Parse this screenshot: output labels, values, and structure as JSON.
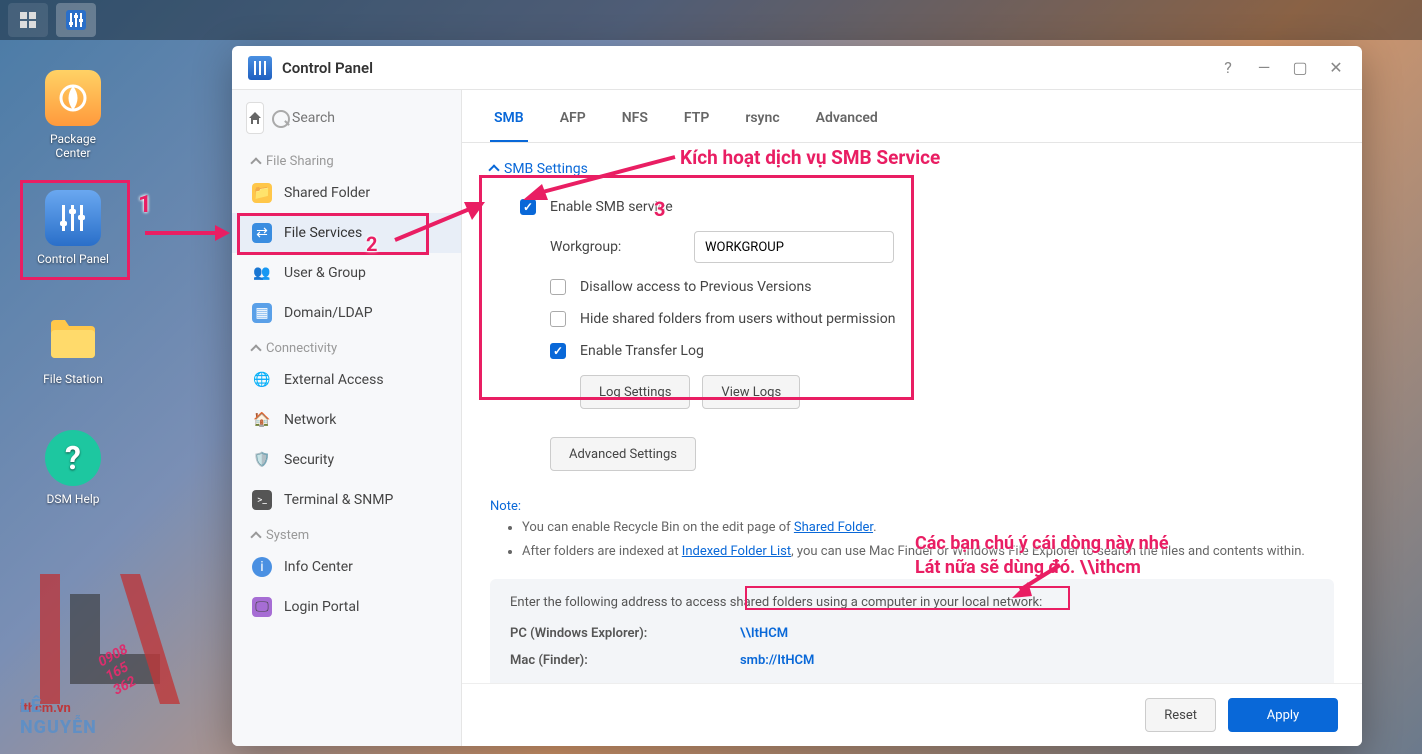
{
  "taskbar": {
    "items": [
      "menu",
      "control-panel-taskbar"
    ]
  },
  "desktop": {
    "package_center": "Package\nCenter",
    "control_panel": "Control Panel",
    "file_station": "File Station",
    "dsm_help": "DSM Help"
  },
  "window": {
    "title": "Control Panel",
    "search_placeholder": "Search"
  },
  "sidebar": {
    "section_file_sharing": "File Sharing",
    "shared_folder": "Shared Folder",
    "file_services": "File Services",
    "user_group": "User & Group",
    "domain_ldap": "Domain/LDAP",
    "section_connectivity": "Connectivity",
    "external_access": "External Access",
    "network": "Network",
    "security": "Security",
    "terminal_snmp": "Terminal & SNMP",
    "section_system": "System",
    "info_center": "Info Center",
    "login_portal": "Login Portal"
  },
  "tabs": {
    "smb": "SMB",
    "afp": "AFP",
    "nfs": "NFS",
    "ftp": "FTP",
    "rsync": "rsync",
    "advanced": "Advanced"
  },
  "content": {
    "section_header": "SMB Settings",
    "enable_smb": "Enable SMB service",
    "workgroup_label": "Workgroup:",
    "workgroup_value": "WORKGROUP",
    "disallow_prev": "Disallow access to Previous Versions",
    "hide_folders": "Hide shared folders from users without permission",
    "enable_log": "Enable Transfer Log",
    "log_settings": "Log Settings",
    "view_logs": "View Logs",
    "advanced_settings": "Advanced Settings",
    "note_title": "Note:",
    "note1_a": "You can enable Recycle Bin on the edit page of ",
    "note1_link": "Shared Folder",
    "note2_a": "After folders are indexed at ",
    "note2_link": "Indexed Folder List",
    "note2_b": ", you can use Mac Finder or Windows File Explorer to search the files and contents within.",
    "access_intro": "Enter the following address to access shared folders using a computer in your local network:",
    "pc_label": "PC (Windows Explorer):",
    "pc_value": "\\\\ItHCM",
    "mac_label": "Mac (Finder):",
    "mac_value": "smb://ItHCM"
  },
  "footer": {
    "reset": "Reset",
    "apply": "Apply"
  },
  "annotations": {
    "n1": "1",
    "n2": "2",
    "n3": "3",
    "text1": "Kích hoạt dịch vụ SMB Service",
    "text2_line1": "Các bạn chú ý cái dòng này nhé",
    "text2_line2": "Lát nữa sẽ dùng đó. \\\\ithcm"
  },
  "watermark": {
    "brand": "LÊ NGUYỄN",
    "phone": "0908 165 362",
    "site": "ithcm.vn"
  }
}
